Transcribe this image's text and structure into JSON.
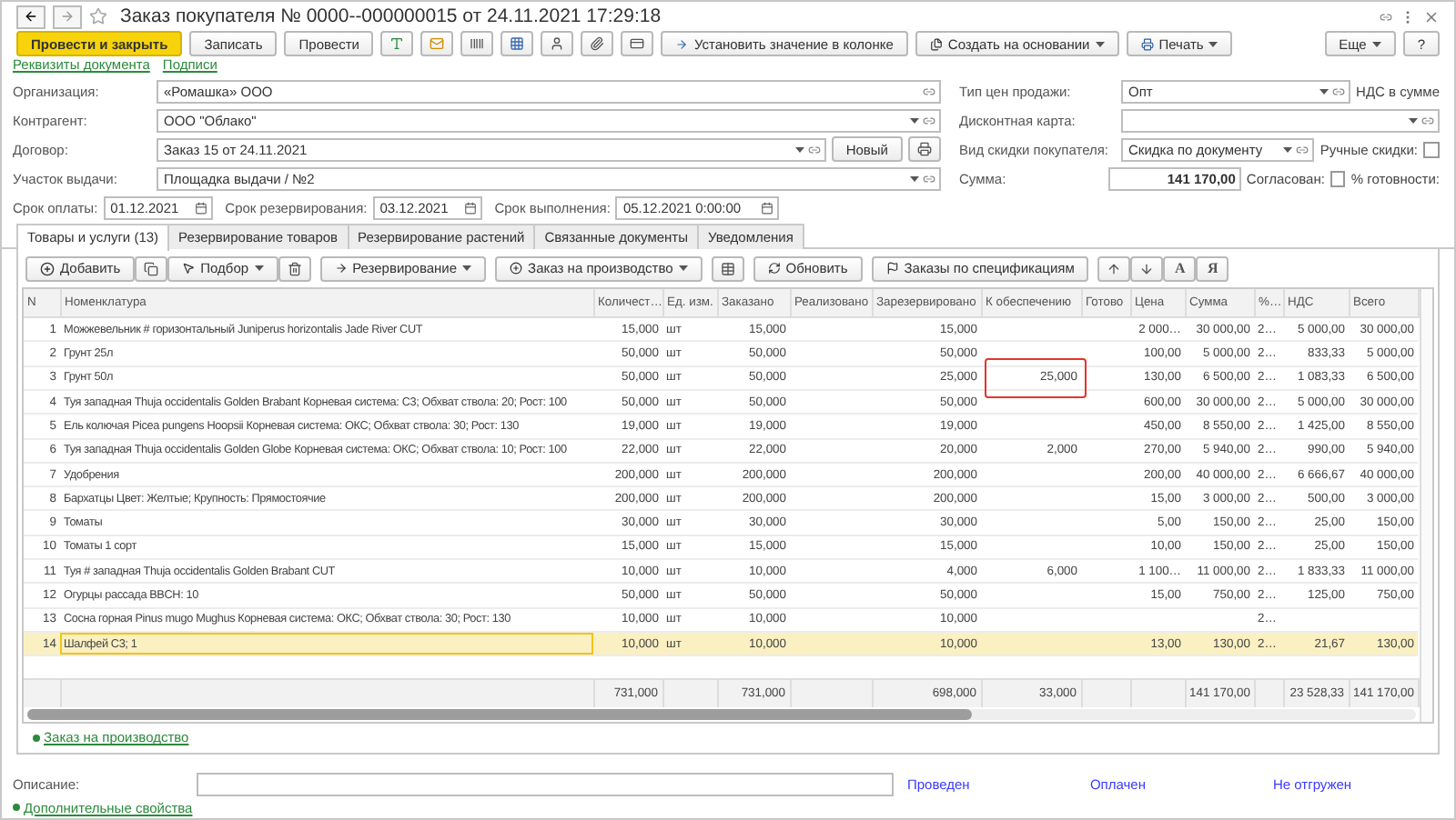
{
  "window": {
    "title": "Заказ покупателя № 0000--000000015 от 24.11.2021 17:29:18"
  },
  "toolbar": {
    "buttons": [
      {
        "label": "Провести и закрыть",
        "kind": "primary"
      },
      {
        "label": "Записать",
        "kind": "plain"
      },
      {
        "label": "Провести",
        "kind": "plain"
      }
    ],
    "set_value": "Установить значение в колонке",
    "create_based": "Создать на основании",
    "print": "Печать",
    "more": "Еще",
    "help": "?"
  },
  "links": [
    "Реквизиты документа",
    "Подписи"
  ],
  "fields_left": [
    {
      "label": "Организация:",
      "value": "«Ромашка» ООО",
      "dropdown": false
    },
    {
      "label": "Контрагент:",
      "value": "ООО \"Облако\"",
      "dropdown": true
    },
    {
      "label": "Договор:",
      "value": "Заказ 15 от 24.11.2021",
      "dropdown": true,
      "button": "Новый"
    },
    {
      "label": "Участок выдачи:",
      "value": "Площадка выдачи / №2",
      "dropdown": true
    }
  ],
  "dates": [
    {
      "label": "Срок оплаты:",
      "value": "01.12.2021"
    },
    {
      "label": "Срок резервирования:",
      "value": "03.12.2021"
    },
    {
      "label": "Срок выполнения:",
      "value": "05.12.2021  0:00:00"
    }
  ],
  "fields_right": [
    {
      "label": "Тип цен продажи:",
      "value": "Опт",
      "dropdown": true,
      "note": "НДС в сумме"
    },
    {
      "label": "Дисконтная карта:",
      "dropdown": true
    },
    {
      "label": "Вид скидки покупателя:",
      "value": "Скидка по документу",
      "dropdown": true,
      "checkbox": {
        "label": "Ручные скидки:",
        "checked": false
      }
    }
  ],
  "sum": {
    "label": "Сумма:",
    "value": "141 170,00",
    "checkbox": {
      "label": "Согласован:",
      "checked": false
    },
    "note": "% готовности:"
  },
  "tabs": [
    {
      "label": "Товары и услуги (13)",
      "selected": true
    },
    {
      "label": "Резервирование товаров",
      "selected": false
    },
    {
      "label": "Резервирование растений",
      "selected": false
    },
    {
      "label": "Связанные документы",
      "selected": false
    },
    {
      "label": "Уведомления",
      "selected": false
    }
  ],
  "table_toolbar": {
    "add": "Добавить",
    "pick": "Подбор",
    "reserve": "Резервирование",
    "production": "Заказ на производство",
    "refresh": "Обновить",
    "by_spec": "Заказы по спецификациям",
    "format": [
      "A",
      "Я"
    ]
  },
  "table": {
    "columns": [
      "N",
      "Номенклатура",
      "Количест…",
      "Ед. изм.",
      "Заказано",
      "Реализовано",
      "Зарезервировано",
      "К обеспечению",
      "Готово",
      "Цена",
      "Сумма",
      "%…",
      "НДС",
      "Всего"
    ],
    "rows": [
      {
        "selected": false,
        "n": "1",
        "name": "Можжевельник # горизонтальный Juniperus horizontalis Jade River CUT",
        "quantity": "15,000",
        "unit": "шт",
        "ordered": "15,000",
        "reserved": "15,000",
        "price": "2 000…",
        "sum": "30 000,00",
        "vat_rate": "2…",
        "vat": "5 000,00",
        "total": "30 000,00"
      },
      {
        "selected": false,
        "n": "2",
        "name": "Грунт 25л",
        "quantity": "50,000",
        "unit": "шт",
        "ordered": "50,000",
        "reserved": "50,000",
        "price": "100,00",
        "sum": "5 000,00",
        "vat_rate": "2…",
        "vat": "833,33",
        "total": "5 000,00"
      },
      {
        "selected": false,
        "n": "3",
        "name": "Грунт 50л",
        "quantity": "50,000",
        "unit": "шт",
        "ordered": "50,000",
        "reserved": "25,000",
        "to_provide": "25,000",
        "to_provide_outlined": true,
        "price": "130,00",
        "sum": "6 500,00",
        "vat_rate": "2…",
        "vat": "1 083,33",
        "total": "6 500,00"
      },
      {
        "selected": false,
        "n": "4",
        "name": "Туя западная Thuja occidentalis Golden Brabant  Корневая система: С3; Обхват ствола: 20; Рост: 100",
        "quantity": "50,000",
        "unit": "шт",
        "ordered": "50,000",
        "reserved": "50,000",
        "price": "600,00",
        "sum": "30 000,00",
        "vat_rate": "2…",
        "vat": "5 000,00",
        "total": "30 000,00"
      },
      {
        "selected": false,
        "n": "5",
        "name": "Ель колючая Picea pungens Hoopsii Корневая система: ОКС; Обхват ствола: 30; Рост: 130",
        "quantity": "19,000",
        "unit": "шт",
        "ordered": "19,000",
        "reserved": "19,000",
        "price": "450,00",
        "sum": "8 550,00",
        "vat_rate": "2…",
        "vat": "1 425,00",
        "total": "8 550,00"
      },
      {
        "selected": false,
        "n": "6",
        "name": "Туя западная Thuja occidentalis Golden Globe  Корневая система: ОКС; Обхват ствола: 10; Рост: 100",
        "quantity": "22,000",
        "unit": "шт",
        "ordered": "22,000",
        "reserved": "20,000",
        "to_provide": "2,000",
        "price": "270,00",
        "sum": "5 940,00",
        "vat_rate": "2…",
        "vat": "990,00",
        "total": "5 940,00"
      },
      {
        "selected": false,
        "n": "7",
        "name": "Удобрения",
        "quantity": "200,000",
        "unit": "шт",
        "ordered": "200,000",
        "reserved": "200,000",
        "price": "200,00",
        "sum": "40 000,00",
        "vat_rate": "2…",
        "vat": "6 666,67",
        "total": "40 000,00"
      },
      {
        "selected": false,
        "n": "8",
        "name": "Бархатцы Цвет: Желтые; Крупность: Прямостоячие",
        "quantity": "200,000",
        "unit": "шт",
        "ordered": "200,000",
        "reserved": "200,000",
        "price": "15,00",
        "sum": "3 000,00",
        "vat_rate": "2…",
        "vat": "500,00",
        "total": "3 000,00"
      },
      {
        "selected": false,
        "n": "9",
        "name": "Томаты",
        "quantity": "30,000",
        "unit": "шт",
        "ordered": "30,000",
        "reserved": "30,000",
        "price": "5,00",
        "sum": "150,00",
        "vat_rate": "2…",
        "vat": "25,00",
        "total": "150,00"
      },
      {
        "selected": false,
        "n": "10",
        "name": "Томаты 1 сорт",
        "quantity": "15,000",
        "unit": "шт",
        "ordered": "15,000",
        "reserved": "15,000",
        "price": "10,00",
        "sum": "150,00",
        "vat_rate": "2…",
        "vat": "25,00",
        "total": "150,00"
      },
      {
        "selected": false,
        "n": "11",
        "name": "Туя # западная Thuja occidentalis Golden Brabant CUT",
        "quantity": "10,000",
        "unit": "шт",
        "ordered": "10,000",
        "reserved": "4,000",
        "to_provide": "6,000",
        "price": "1 100…",
        "sum": "11 000,00",
        "vat_rate": "2…",
        "vat": "1 833,33",
        "total": "11 000,00"
      },
      {
        "selected": false,
        "n": "12",
        "name": "Огурцы рассада BBCH: 10",
        "quantity": "50,000",
        "unit": "шт",
        "ordered": "50,000",
        "reserved": "50,000",
        "price": "15,00",
        "sum": "750,00",
        "vat_rate": "2…",
        "vat": "125,00",
        "total": "750,00"
      },
      {
        "selected": false,
        "n": "13",
        "name": "Сосна горная Pinus mugo Mughus  Корневая система: ОКС; Обхват ствола: 30; Рост: 130",
        "quantity": "10,000",
        "unit": "шт",
        "ordered": "10,000",
        "reserved": "10,000",
        "vat_rate": "2…"
      },
      {
        "selected": true,
        "n": "14",
        "name": "Шалфей С3; 1",
        "name_focused": true,
        "quantity": "10,000",
        "unit": "шт",
        "ordered": "10,000",
        "reserved": "10,000",
        "price": "13,00",
        "sum": "130,00",
        "vat_rate": "2…",
        "vat": "21,67",
        "total": "130,00"
      }
    ],
    "totals": {
      "quantity": "731,000",
      "ordered": "731,000",
      "reserved": "698,000",
      "to_provide": "33,000",
      "sum": "141 170,00",
      "vat": "23 528,33",
      "total": "141 170,00"
    }
  },
  "production_link": "Заказ на производство",
  "description": {
    "label": "Описание:"
  },
  "statuses": [
    "Проведен",
    "Оплачен",
    "Не отгружен"
  ],
  "extra_link": "Дополнительные свойства"
}
